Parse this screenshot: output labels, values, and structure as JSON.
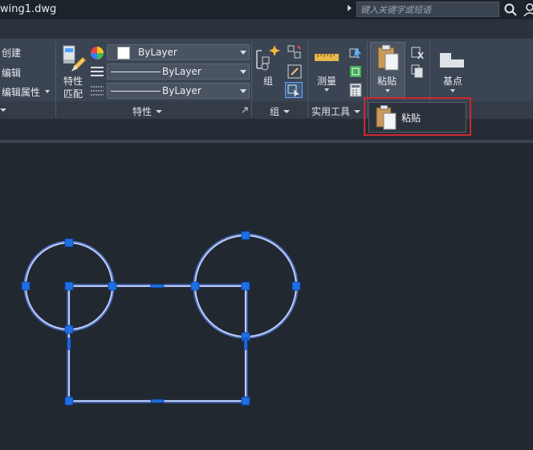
{
  "title": "wing1.dwg",
  "search": {
    "placeholder": "键入关键字或短语"
  },
  "block_panel": {
    "create_label": "创建",
    "edit_label": "编辑",
    "edit_attr_label": "编辑属性"
  },
  "properties_panel": {
    "match_label_1": "特性",
    "match_label_2": "匹配",
    "color_value": "ByLayer",
    "linetype_value": "ByLayer",
    "lineweight_value": "ByLayer",
    "title": "特性"
  },
  "group_panel": {
    "group_label": "组",
    "title": "组"
  },
  "utilities_panel": {
    "measure_label": "测量",
    "title": "实用工具"
  },
  "clipboard_panel": {
    "paste_label": "粘贴"
  },
  "view_panel": {
    "base_label": "基点"
  },
  "paste_dropdown": {
    "item_label": "粘贴"
  },
  "colors": {
    "background": "#212830",
    "ribbon": "#3b4452",
    "selection": "#5a8cff",
    "grip": "#1e6fe6",
    "highlight": "#d0282f"
  }
}
